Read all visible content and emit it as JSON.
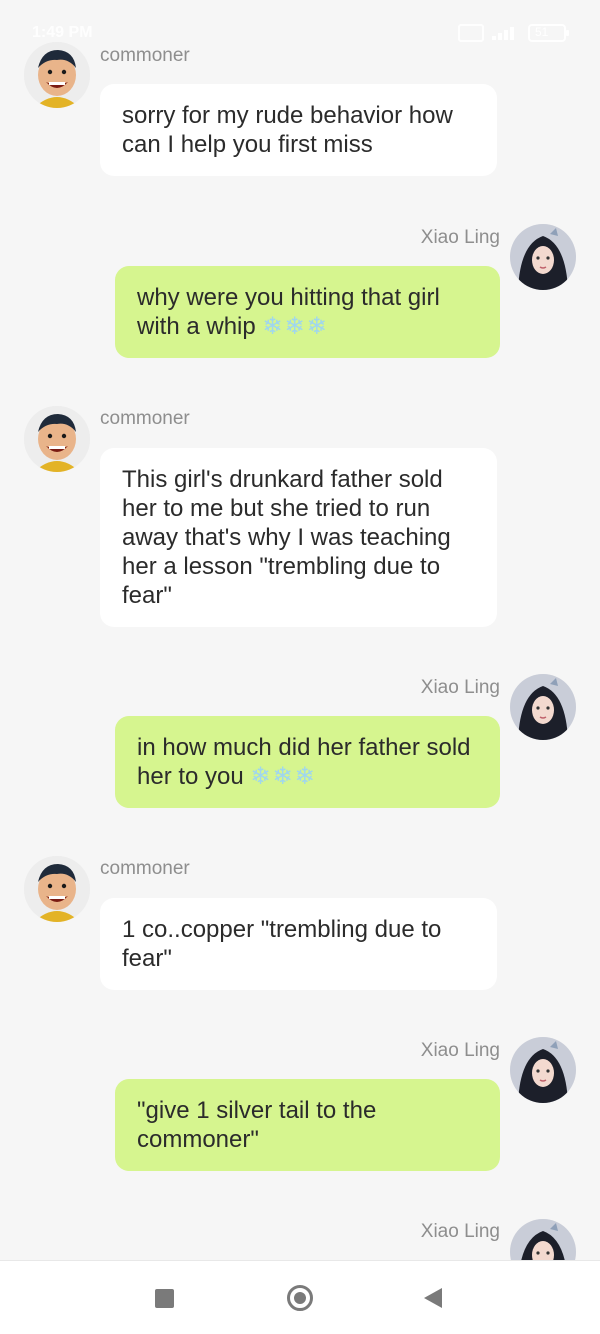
{
  "status_bar": {
    "time": "1:49 PM",
    "battery": "51"
  },
  "messages": [
    {
      "sender": "commoner",
      "text": "sorry for my rude behavior how can I help you first miss"
    },
    {
      "sender": "Xiao Ling",
      "text": "why were you hitting that girl with a whip",
      "emoji": "❄❄❄"
    },
    {
      "sender": "commoner",
      "text": "This girl's drunkard father sold her to me but she tried to run away that's why I was teaching her a lesson \"trembling due to fear\""
    },
    {
      "sender": "Xiao Ling",
      "text": "in how much did her father sold her to you",
      "emoji": "❄❄❄"
    },
    {
      "sender": "commoner",
      "text": "1 co..copper \"trembling due to fear\""
    },
    {
      "sender": "Xiao Ling",
      "text": "\"give 1 silver tail to the commoner\""
    },
    {
      "sender": "Xiao Ling",
      "text": ""
    }
  ]
}
